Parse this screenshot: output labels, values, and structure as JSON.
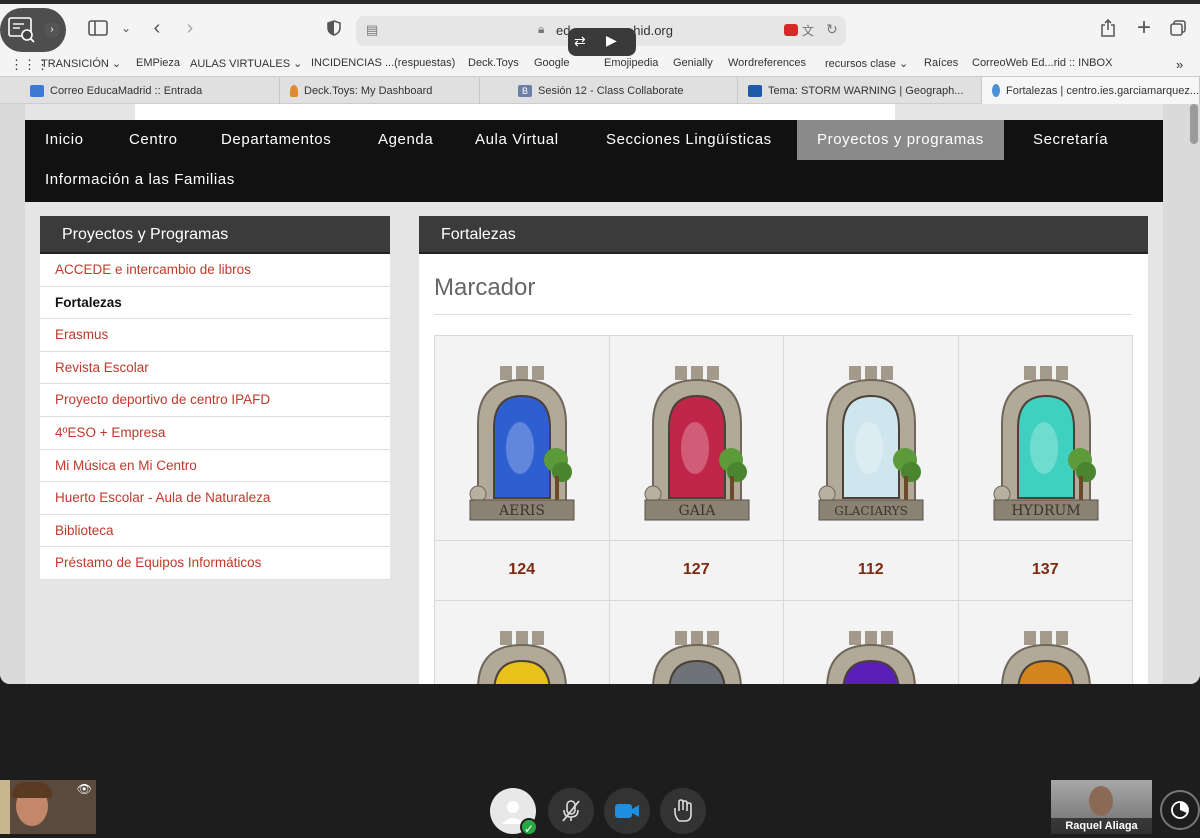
{
  "browser": {
    "url": "ed··· ··· ··· ···hid.org",
    "bookmarks": [
      "TRANSICIÓN ⌄",
      "EMPieza",
      "AULAS VIRTUALES ⌄",
      "INCIDENCIAS ...(respuestas)",
      "Deck.Toys",
      "Google",
      "Emojipedia",
      "Genially",
      "Wordreferences",
      "recursos clase ⌄",
      "Raíces",
      "CorreoWeb Ed...rid :: INBOX"
    ],
    "tabs": [
      {
        "label": "Correo EducaMadrid :: Entrada",
        "color": "#3b7bd4"
      },
      {
        "label": "Deck.Toys: My Dashboard",
        "color": "#e08a2c"
      },
      {
        "label": "Sesión 12 - Class Collaborate",
        "color": "#6b7fa8"
      },
      {
        "label": "Tema: STORM WARNING | Geograph...",
        "color": "#1f5aa8"
      },
      {
        "label": "Fortalezas | centro.ies.garciamarquez...",
        "color": "#4a8fd8"
      }
    ]
  },
  "nav": {
    "items": [
      "Inicio",
      "Centro",
      "Departamentos",
      "Agenda",
      "Aula Virtual",
      "Secciones Lingüísticas",
      "Proyectos y programas",
      "Secretaría",
      "Información a las Familias"
    ],
    "active": "Proyectos y programas"
  },
  "sidebar": {
    "title": "Proyectos y Programas",
    "items": [
      "ACCEDE e intercambio de libros",
      "Fortalezas",
      "Erasmus",
      "Revista Escolar",
      "Proyecto deportivo de centro IPAFD",
      "4ºESO + Empresa",
      "Mi Música en Mi Centro",
      "Huerto Escolar - Aula de Naturaleza",
      "Biblioteca",
      "Préstamo de Equipos Informáticos"
    ],
    "current": "Fortalezas"
  },
  "main": {
    "title": "Fortalezas",
    "heading": "Marcador",
    "teams": [
      {
        "name": "AERIS",
        "score": "124",
        "color": "#2d5fd0",
        "icon": "falcon-icon"
      },
      {
        "name": "GAIA",
        "score": "127",
        "color": "#c0264a",
        "icon": "wolf-icon"
      },
      {
        "name": "GLACIARYS",
        "score": "112",
        "color": "#cfe6ee",
        "icon": "polar-bear-icon"
      },
      {
        "name": "HYDRUM",
        "score": "137",
        "color": "#3fd0c0",
        "icon": "dolphin-icon"
      }
    ],
    "next_row_colors": [
      "#e8c21a",
      "#6f7378",
      "#5a1fb8",
      "#d4861e"
    ]
  },
  "call": {
    "remote_name": "Raquel Aliaga"
  }
}
